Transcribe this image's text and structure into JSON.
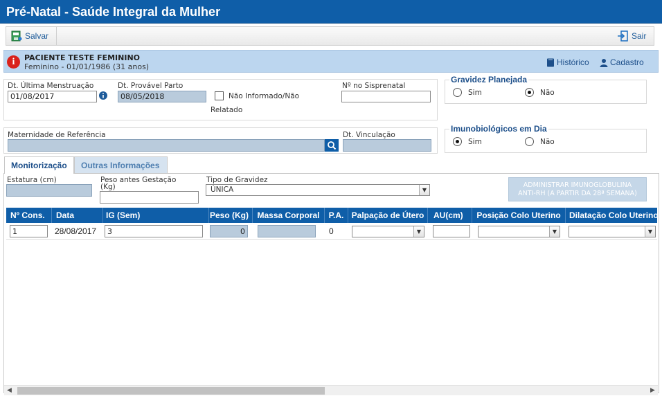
{
  "window": {
    "title": "Pré-Natal - Saúde Integral da Mulher"
  },
  "toolbar": {
    "save_label": "Salvar",
    "exit_label": "Sair"
  },
  "patient": {
    "name": "PACIENTE TESTE FEMININO",
    "info": "Feminino - 01/01/1986 (31 anos)",
    "history_label": "Histórico",
    "register_label": "Cadastro"
  },
  "form": {
    "dum_label": "Dt. Última Menstruação",
    "dum_value": "01/08/2017",
    "dpp_label": "Dt. Provável Parto",
    "dpp_value": "08/05/2018",
    "not_informed_label": "Não Informado/Não",
    "not_informed_label2": "Relatado",
    "sisprenatal_label": "Nº no Sisprenatal",
    "sisprenatal_value": "",
    "maternity_label": "Maternidade de Referência",
    "maternity_value": "",
    "link_date_label": "Dt. Vinculação",
    "link_date_value": ""
  },
  "planned": {
    "legend": "Gravidez Planejada",
    "yes_label": "Sim",
    "no_label": "Não",
    "selected": "Não"
  },
  "immuno": {
    "legend": "Imunobiológicos em Dia",
    "yes_label": "Sim",
    "no_label": "Não",
    "selected": "Sim"
  },
  "tabs": [
    {
      "label": "Monitorização",
      "active": true
    },
    {
      "label": "Outras Informações",
      "active": false
    }
  ],
  "monitor": {
    "height_label": "Estatura (cm)",
    "height_value": "",
    "weight_before_label1": "Peso antes Gestação",
    "weight_before_label2": "(Kg)",
    "weight_before_value": "",
    "pregnancy_type_label": "Tipo de Gravidez",
    "pregnancy_type_value": "ÚNICA",
    "anti_rh_line1": "ADMINISTRAR IMUNOGLOBULINA",
    "anti_rh_line2": "ANTI-RH (A PARTIR DA 28ª SEMANA)"
  },
  "table": {
    "columns": [
      "Nº Cons.",
      "Data",
      "IG (Sem)",
      "Peso (Kg)",
      "Massa Corporal",
      "P.A.",
      "Palpação de Útero",
      "AU(cm)",
      "Posição Colo Uterino",
      "Dilatação Colo Uterino"
    ],
    "rows": [
      {
        "cons": "1",
        "data": "28/08/2017",
        "ig": "3",
        "peso": "0",
        "massa": "",
        "pa": "0",
        "palpacao": "",
        "au": "",
        "posicao": "",
        "dilatacao": ""
      }
    ]
  },
  "colors": {
    "primary": "#0f5ea8",
    "banner": "#bcd6ef",
    "alert": "#d9221c"
  }
}
